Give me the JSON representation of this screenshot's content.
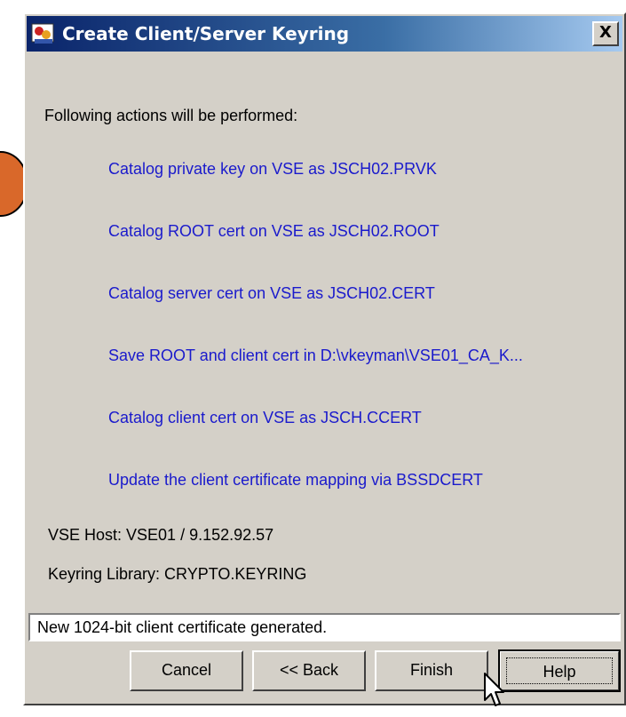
{
  "window": {
    "title": "Create Client/Server Keyring",
    "close_label": "X"
  },
  "content": {
    "intro": "Following actions will be performed:",
    "actions": [
      "Catalog private key on VSE as JSCH02.PRVK",
      "Catalog ROOT cert on VSE as JSCH02.ROOT",
      "Catalog server cert on VSE as JSCH02.CERT",
      "Save ROOT and client cert in D:\\vkeyman\\VSE01_CA_K...",
      "Catalog client cert on VSE as JSCH.CCERT",
      "Update the client certificate mapping via BSSDCERT"
    ],
    "vse_host": "VSE Host: VSE01 / 9.152.92.57",
    "keyring_library": "Keyring Library: CRYPTO.KEYRING"
  },
  "status": {
    "text": "New 1024-bit client certificate generated."
  },
  "buttons": {
    "cancel": "Cancel",
    "back": "<< Back",
    "finish": "Finish",
    "help": "Help"
  },
  "colors": {
    "action_text": "#1a1acc",
    "titlebar_start": "#0a246a",
    "titlebar_end": "#a6caf0",
    "dialog_bg": "#d4d0c8"
  },
  "icons": {
    "title_icon": "keyring-app-icon",
    "close": "close-icon",
    "cursor": "mouse-pointer-icon"
  }
}
